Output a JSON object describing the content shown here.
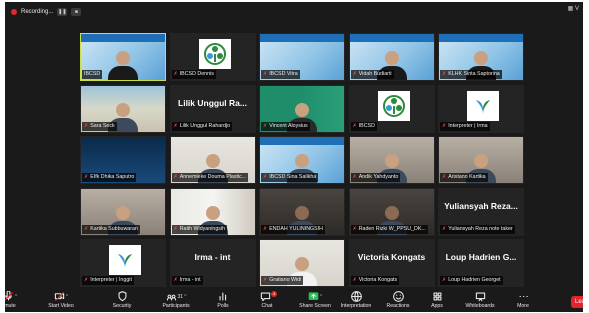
{
  "recording": {
    "label": "Recording..."
  },
  "view_label": "V",
  "participants": [
    {
      "name": "IBCSD",
      "bigname": "",
      "muted": false,
      "active": true,
      "kind": "slide-person"
    },
    {
      "name": "IBCSD Dennis",
      "bigname": "",
      "muted": true,
      "active": false,
      "kind": "logo"
    },
    {
      "name": "IBCSD Vitra",
      "bigname": "",
      "muted": true,
      "active": false,
      "kind": "slide"
    },
    {
      "name": "Vidah Budiarti",
      "bigname": "",
      "muted": true,
      "active": false,
      "kind": "slide-person"
    },
    {
      "name": "KLHK Sinta Saptorina",
      "bigname": "",
      "muted": true,
      "active": false,
      "kind": "slide-person"
    },
    {
      "name": "Sara Seck",
      "bigname": "",
      "muted": true,
      "active": false,
      "kind": "person-outdoor"
    },
    {
      "name": "Lilik Unggul Rahardjo",
      "bigname": "Lilik Unggul Ra...",
      "muted": true,
      "active": false,
      "kind": "name"
    },
    {
      "name": "Vincent Aloysius",
      "bigname": "",
      "muted": true,
      "active": false,
      "kind": "person-green"
    },
    {
      "name": "IBCSD",
      "bigname": "",
      "muted": true,
      "active": false,
      "kind": "logo"
    },
    {
      "name": "Interpreter | Irma",
      "bigname": "",
      "muted": true,
      "active": false,
      "kind": "logo-plant"
    },
    {
      "name": "EIfk Dhika Saputro",
      "bigname": "",
      "muted": true,
      "active": false,
      "kind": "epson"
    },
    {
      "name": "Annemieke Douma Plastic...",
      "bigname": "",
      "muted": true,
      "active": false,
      "kind": "person-light"
    },
    {
      "name": "IBCSD Sina Salikha",
      "bigname": "",
      "muted": true,
      "active": false,
      "kind": "slide-person-mask"
    },
    {
      "name": "Andik Yahdyanto",
      "bigname": "",
      "muted": true,
      "active": false,
      "kind": "person-room"
    },
    {
      "name": "Aristano Kartika",
      "bigname": "",
      "muted": true,
      "active": false,
      "kind": "person-room"
    },
    {
      "name": "Kartika Subbuwaran",
      "bigname": "",
      "muted": true,
      "active": false,
      "kind": "person-room"
    },
    {
      "name": "Ratih Widyaningsih",
      "bigname": "",
      "muted": true,
      "active": false,
      "kind": "person-window"
    },
    {
      "name": "ENDAH YULININGSIH",
      "bigname": "",
      "muted": true,
      "active": false,
      "kind": "person-dark"
    },
    {
      "name": "Raden Rizki W_PPSU_DK...",
      "bigname": "",
      "muted": true,
      "active": false,
      "kind": "person-dark"
    },
    {
      "name": "Yuliansyah Reza note taker",
      "bigname": "Yuliansyah Reza...",
      "muted": true,
      "active": false,
      "kind": "name"
    },
    {
      "name": "Interpreter | Inggit",
      "bigname": "",
      "muted": true,
      "active": false,
      "kind": "logo-plant"
    },
    {
      "name": "Irma - int",
      "bigname": "Irma - int",
      "muted": true,
      "active": false,
      "kind": "name"
    },
    {
      "name": "Gratiano Widi",
      "bigname": "",
      "muted": true,
      "active": false,
      "kind": "person-white"
    },
    {
      "name": "Victoria Kongats",
      "bigname": "Victoria Kongats",
      "muted": true,
      "active": false,
      "kind": "name"
    },
    {
      "name": "Loup Hadrien Georget",
      "bigname": "Loup Hadrien G...",
      "muted": true,
      "active": false,
      "kind": "name"
    }
  ],
  "toolbar": {
    "mute": {
      "label": "mute",
      "icon": "microphone-icon"
    },
    "video": {
      "label": "Start Video",
      "icon": "video-camera-icon"
    },
    "security": {
      "label": "Security",
      "icon": "shield-icon"
    },
    "participants": {
      "label": "Participants",
      "icon": "people-icon",
      "count": "31"
    },
    "polls": {
      "label": "Polls",
      "icon": "bar-chart-icon"
    },
    "chat": {
      "label": "Chat",
      "icon": "chat-bubble-icon",
      "badge": "4"
    },
    "share": {
      "label": "Share Screen",
      "icon": "share-screen-icon"
    },
    "interpretation": {
      "label": "Interpretation",
      "icon": "globe-icon"
    },
    "reactions": {
      "label": "Reactions",
      "icon": "smiley-icon"
    },
    "apps": {
      "label": "Apps",
      "icon": "apps-icon"
    },
    "whiteboards": {
      "label": "Whiteboards",
      "icon": "whiteboard-icon"
    },
    "more": {
      "label": "More",
      "icon": "dots-icon"
    },
    "leave": {
      "label": "Leav"
    }
  },
  "colors": {
    "accent": "#2bbd5c",
    "mute_red": "#ff4444",
    "active_border": "#c8e04a",
    "leave": "#e0262c"
  }
}
